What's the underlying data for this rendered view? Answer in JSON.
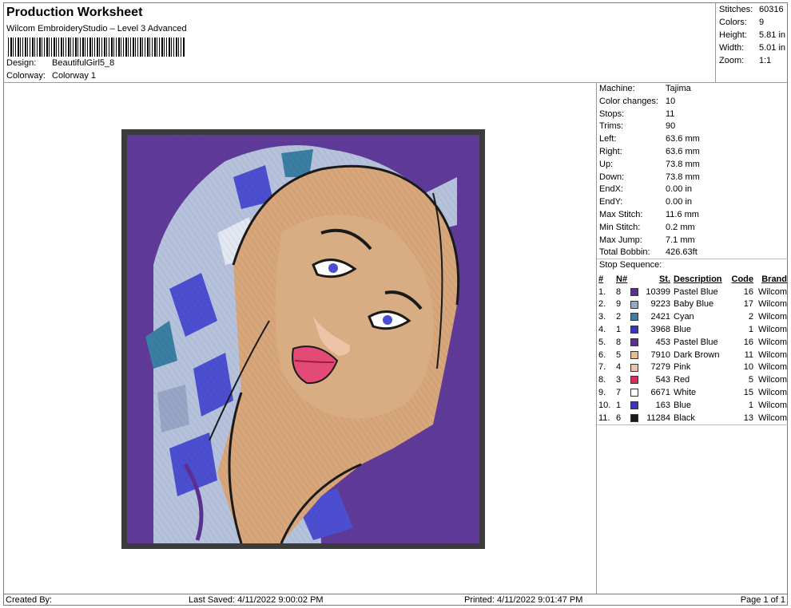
{
  "header": {
    "title": "Production Worksheet",
    "subtitle": "Wilcom EmbroideryStudio – Level 3 Advanced",
    "design_label": "Design:",
    "design_value": "BeautifulGirl5_8",
    "colorway_label": "Colorway:",
    "colorway_value": "Colorway 1"
  },
  "summary": [
    {
      "k": "Stitches:",
      "v": "60316"
    },
    {
      "k": "Colors:",
      "v": "9"
    },
    {
      "k": "Height:",
      "v": "5.81 in"
    },
    {
      "k": "Width:",
      "v": "5.01 in"
    },
    {
      "k": "Zoom:",
      "v": "1:1"
    }
  ],
  "specs": [
    {
      "k": "Machine:",
      "v": "Tajima"
    },
    {
      "k": "Color changes:",
      "v": "10"
    },
    {
      "k": "Stops:",
      "v": "11"
    },
    {
      "k": "Trims:",
      "v": "90"
    },
    {
      "k": "Left:",
      "v": "63.6 mm"
    },
    {
      "k": "Right:",
      "v": "63.6 mm"
    },
    {
      "k": "Up:",
      "v": "73.8 mm"
    },
    {
      "k": "Down:",
      "v": "73.8 mm"
    },
    {
      "k": "EndX:",
      "v": "0.00 in"
    },
    {
      "k": "EndY:",
      "v": "0.00 in"
    },
    {
      "k": "Max Stitch:",
      "v": "11.6 mm"
    },
    {
      "k": "Min Stitch:",
      "v": "0.2 mm"
    },
    {
      "k": "Max Jump:",
      "v": "7.1 mm"
    },
    {
      "k": "Total Bobbin:",
      "v": "426.63ft"
    }
  ],
  "stop_sequence": {
    "heading": "Stop Sequence:",
    "columns": [
      "#",
      "N#",
      "St.",
      "Description",
      "Code",
      "Brand"
    ],
    "rows": [
      {
        "num": "1.",
        "n": "8",
        "color": "#5b2f91",
        "st": "10399",
        "desc": "Pastel Blue",
        "code": "16",
        "brand": "Wilcom"
      },
      {
        "num": "2.",
        "n": "9",
        "color": "#98a6c6",
        "st": "9223",
        "desc": "Baby Blue",
        "code": "17",
        "brand": "Wilcom"
      },
      {
        "num": "3.",
        "n": "2",
        "color": "#3a7ea2",
        "st": "2421",
        "desc": "Cyan",
        "code": "2",
        "brand": "Wilcom"
      },
      {
        "num": "4.",
        "n": "1",
        "color": "#3b34c0",
        "st": "3968",
        "desc": "Blue",
        "code": "1",
        "brand": "Wilcom"
      },
      {
        "num": "5.",
        "n": "8",
        "color": "#5b2f91",
        "st": "453",
        "desc": "Pastel Blue",
        "code": "16",
        "brand": "Wilcom"
      },
      {
        "num": "6.",
        "n": "5",
        "color": "#eab994",
        "st": "7910",
        "desc": "Dark Brown",
        "code": "11",
        "brand": "Wilcom"
      },
      {
        "num": "7.",
        "n": "4",
        "color": "#eec4a8",
        "st": "7279",
        "desc": "Pink",
        "code": "10",
        "brand": "Wilcom"
      },
      {
        "num": "8.",
        "n": "3",
        "color": "#d92d5f",
        "st": "543",
        "desc": "Red",
        "code": "5",
        "brand": "Wilcom"
      },
      {
        "num": "9.",
        "n": "7",
        "color": "#ffffff",
        "st": "6671",
        "desc": "White",
        "code": "15",
        "brand": "Wilcom"
      },
      {
        "num": "10.",
        "n": "1",
        "color": "#3b34c0",
        "st": "163",
        "desc": "Blue",
        "code": "1",
        "brand": "Wilcom"
      },
      {
        "num": "11.",
        "n": "6",
        "color": "#1a1a1a",
        "st": "11284",
        "desc": "Black",
        "code": "13",
        "brand": "Wilcom"
      }
    ]
  },
  "footer": {
    "created_by": "Created By:",
    "last_saved": "Last Saved: 4/11/2022 9:00:02 PM",
    "printed": "Printed: 4/11/2022 9:01:47 PM",
    "page": "Page 1 of 1"
  },
  "design_preview": {
    "background_color": "#5f3a98",
    "border_color": "#3b3b3b",
    "skin_color": "#d9ad83",
    "hair_color": "#d7a67a",
    "lip_color": "#e34a76"
  }
}
